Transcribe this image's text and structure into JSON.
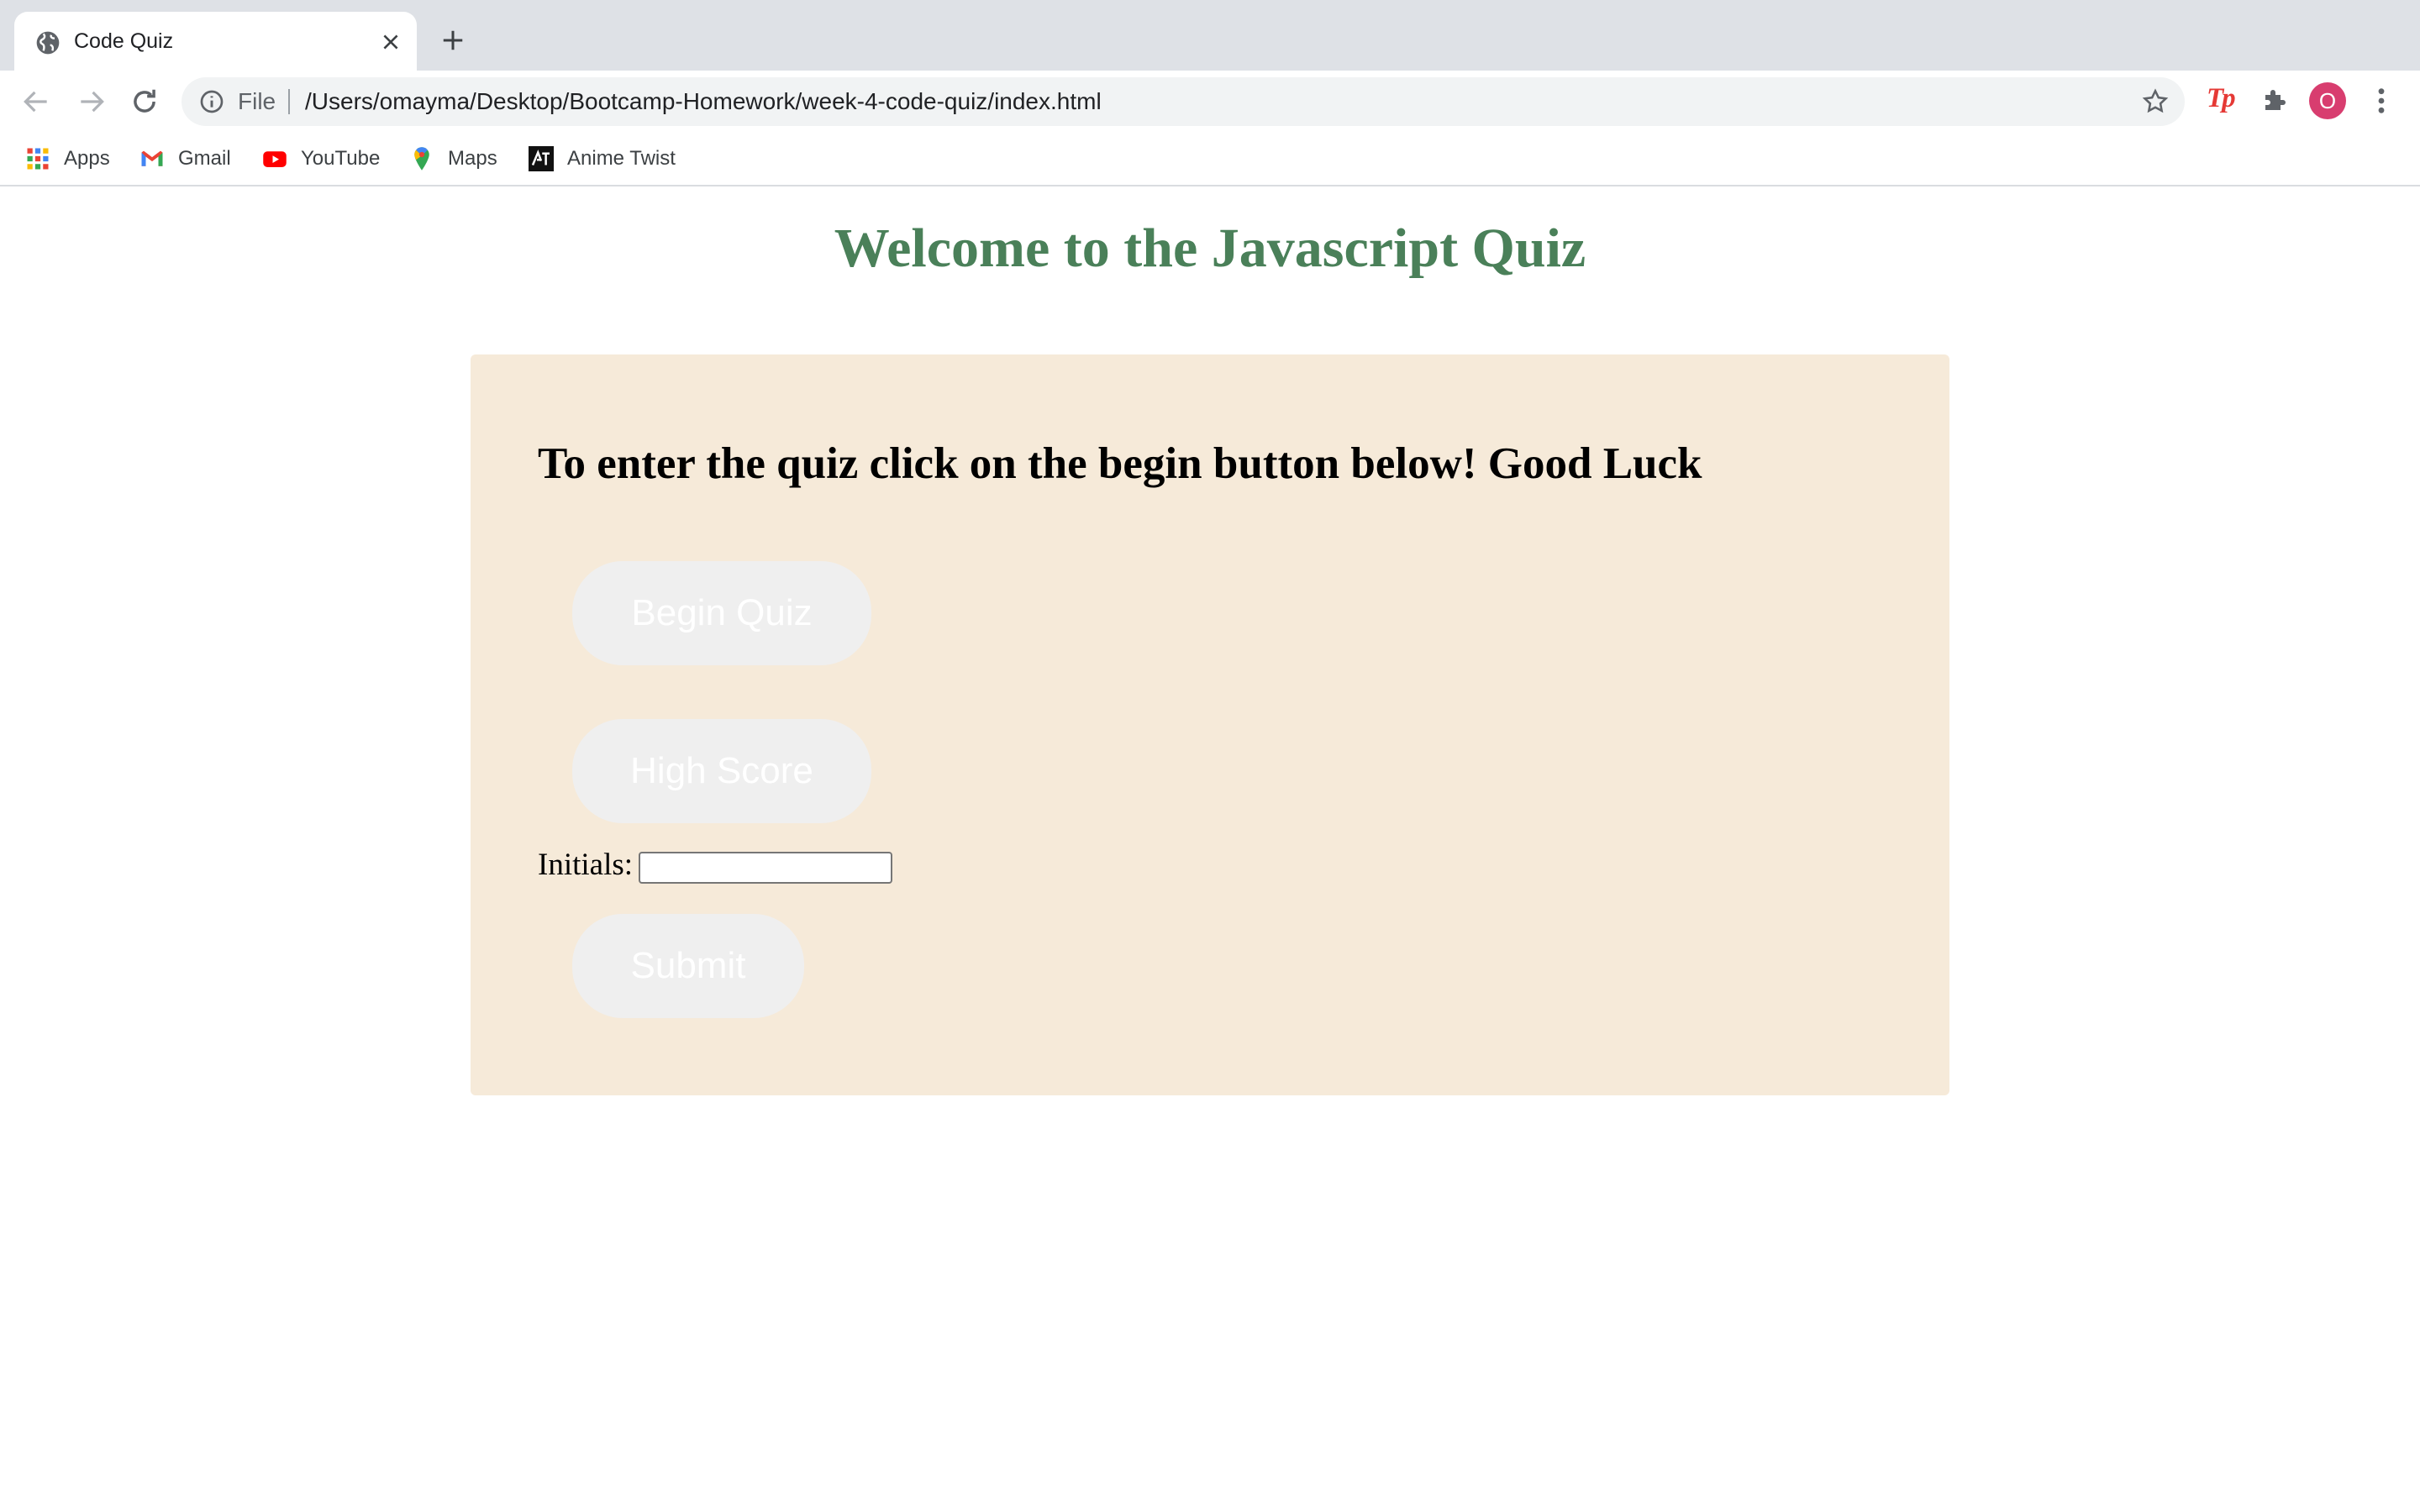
{
  "browser": {
    "tab_title": "Code Quiz",
    "address_scheme": "File",
    "address_url": "/Users/omayma/Desktop/Bootcamp-Homework/week-4-code-quiz/index.html",
    "profile_initial": "O",
    "extension_label": "Tp",
    "bookmarks": [
      {
        "label": "Apps",
        "icon": "apps-grid-icon"
      },
      {
        "label": "Gmail",
        "icon": "gmail-icon"
      },
      {
        "label": "YouTube",
        "icon": "youtube-icon"
      },
      {
        "label": "Maps",
        "icon": "maps-icon"
      },
      {
        "label": "Anime Twist",
        "icon": "anime-twist-icon"
      }
    ]
  },
  "page": {
    "title": "Welcome to the Javascript Quiz",
    "instructions": "To enter the quiz click on the begin button below! Good Luck",
    "begin_label": "Begin Quiz",
    "highscore_label": "High Score",
    "initials_label": "Initials:",
    "initials_value": "",
    "submit_label": "Submit"
  },
  "colors": {
    "title": "#4a8059",
    "card_bg": "#f6ead9",
    "button_bg": "#efefef",
    "profile": "#d83d6f"
  }
}
